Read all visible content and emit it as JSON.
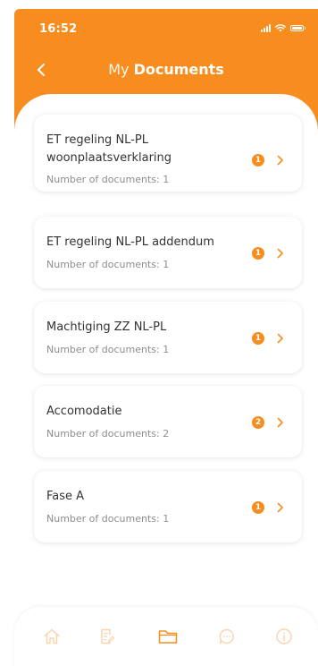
{
  "status_bar": {
    "time": "16:52"
  },
  "header": {
    "title_regular": "My",
    "title_bold": "Documents"
  },
  "documents": [
    {
      "title": "ET regeling NL-PL woonplaatsverklaring",
      "subtitle": "Number of documents: 1",
      "badge": "1"
    },
    {
      "title": "ET regeling NL-PL addendum",
      "subtitle": "Number of documents: 1",
      "badge": "1"
    },
    {
      "title": "Machtiging ZZ NL-PL",
      "subtitle": "Number of documents: 1",
      "badge": "1"
    },
    {
      "title": "Accomodatie",
      "subtitle": "Number of documents: 2",
      "badge": "2"
    },
    {
      "title": "Fase A",
      "subtitle": "Number of documents: 1",
      "badge": "1"
    }
  ],
  "tabs": [
    {
      "icon": "home-icon",
      "active": false
    },
    {
      "icon": "document-edit-icon",
      "active": false
    },
    {
      "icon": "folder-icon",
      "active": true
    },
    {
      "icon": "chat-icon",
      "active": false
    },
    {
      "icon": "info-icon",
      "active": false
    }
  ],
  "colors": {
    "accent": "#f78d1e",
    "card_title": "#333333",
    "card_subtitle": "#8d8d8d",
    "tab_inactive": "#fbd3aa"
  }
}
